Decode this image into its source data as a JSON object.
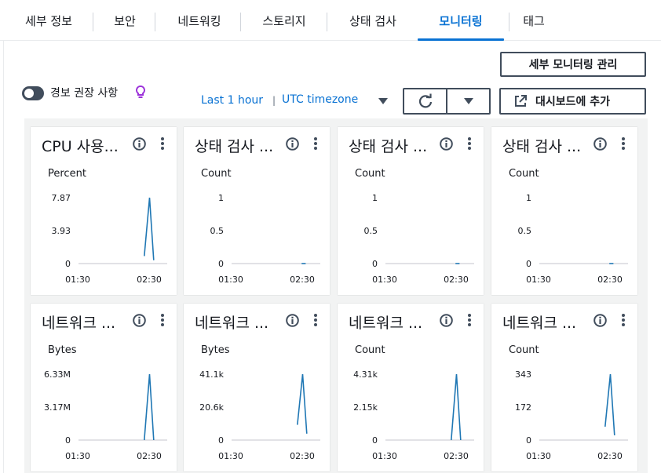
{
  "tabs": [
    {
      "label": "세부 정보"
    },
    {
      "label": "보안"
    },
    {
      "label": "네트워킹"
    },
    {
      "label": "스토리지"
    },
    {
      "label": "상태 검사"
    },
    {
      "label": "모니터링",
      "active": true
    },
    {
      "label": "태그"
    }
  ],
  "toolbar": {
    "manage_detailed_monitoring": "세부 모니터링 관리",
    "alarm_toggle_label": "경보 권장 사항",
    "alarm_toggle_on": false,
    "time_range": "Last 1 hour",
    "timezone": "UTC timezone",
    "add_to_dashboard": "대시보드에 추가"
  },
  "colors": {
    "accent": "#0972d3",
    "line": "#1f77b4",
    "panel_bg": "#f2f3f3",
    "bulb": "#9b30d9"
  },
  "icons": [
    "toggle-switch",
    "lightbulb-icon",
    "caret-down-icon",
    "refresh-icon",
    "external-link-icon",
    "info-icon",
    "kebab-icon"
  ],
  "panels": [
    {
      "title": "CPU 사용...",
      "unit": "Percent",
      "yticks": [
        "7.87",
        "3.93",
        "0"
      ],
      "xticks": [
        "01:30",
        "02:30"
      ],
      "chart_data": {
        "type": "line",
        "ymax": 7.87,
        "x_minutes": [
          0,
          90,
          95,
          100
        ],
        "x_range": [
          -10,
          70
        ],
        "points": [
          [
            58,
            0.9
          ],
          [
            63,
            7.87
          ],
          [
            67,
            0.4
          ]
        ]
      }
    },
    {
      "title": "상태 검사 ...",
      "unit": "Count",
      "yticks": [
        "1",
        "0.5",
        "0"
      ],
      "xticks": [
        "01:30",
        "02:30"
      ],
      "chart_data": {
        "type": "line",
        "ymax": 1,
        "points": [
          [
            62,
            0
          ],
          [
            66,
            0
          ]
        ]
      }
    },
    {
      "title": "상태 검사 ...",
      "unit": "Count",
      "yticks": [
        "1",
        "0.5",
        "0"
      ],
      "xticks": [
        "01:30",
        "02:30"
      ],
      "chart_data": {
        "type": "line",
        "ymax": 1,
        "points": [
          [
            62,
            0
          ],
          [
            66,
            0
          ]
        ]
      }
    },
    {
      "title": "상태 검사 ...",
      "unit": "Count",
      "yticks": [
        "1",
        "0.5",
        "0"
      ],
      "xticks": [
        "01:30",
        "02:30"
      ],
      "chart_data": {
        "type": "line",
        "ymax": 1,
        "points": [
          [
            62,
            0
          ],
          [
            66,
            0
          ]
        ]
      }
    },
    {
      "title": "네트워크 ...",
      "unit": "Bytes",
      "yticks": [
        "6.33M",
        "3.17M",
        "0"
      ],
      "xticks": [
        "01:30",
        "02:30"
      ],
      "chart_data": {
        "type": "line",
        "ymax": 6.33,
        "points": [
          [
            58,
            0
          ],
          [
            63,
            6.33
          ],
          [
            67,
            0
          ]
        ]
      }
    },
    {
      "title": "네트워크 ...",
      "unit": "Bytes",
      "yticks": [
        "41.1k",
        "20.6k",
        "0"
      ],
      "xticks": [
        "01:30",
        "02:30"
      ],
      "chart_data": {
        "type": "line",
        "ymax": 41.1,
        "points": [
          [
            58,
            9.5
          ],
          [
            63,
            41.1
          ],
          [
            67,
            4.0
          ]
        ]
      }
    },
    {
      "title": "네트워크 ...",
      "unit": "Count",
      "yticks": [
        "4.31k",
        "2.15k",
        "0"
      ],
      "xticks": [
        "01:30",
        "02:30"
      ],
      "chart_data": {
        "type": "line",
        "ymax": 4.31,
        "points": [
          [
            58,
            0
          ],
          [
            63,
            4.31
          ],
          [
            67,
            0
          ]
        ]
      }
    },
    {
      "title": "네트워크 ...",
      "unit": "Count",
      "yticks": [
        "343",
        "172",
        "0"
      ],
      "xticks": [
        "01:30",
        "02:30"
      ],
      "chart_data": {
        "type": "line",
        "ymax": 343,
        "points": [
          [
            58,
            70
          ],
          [
            63,
            343
          ],
          [
            67,
            25
          ]
        ]
      }
    }
  ]
}
